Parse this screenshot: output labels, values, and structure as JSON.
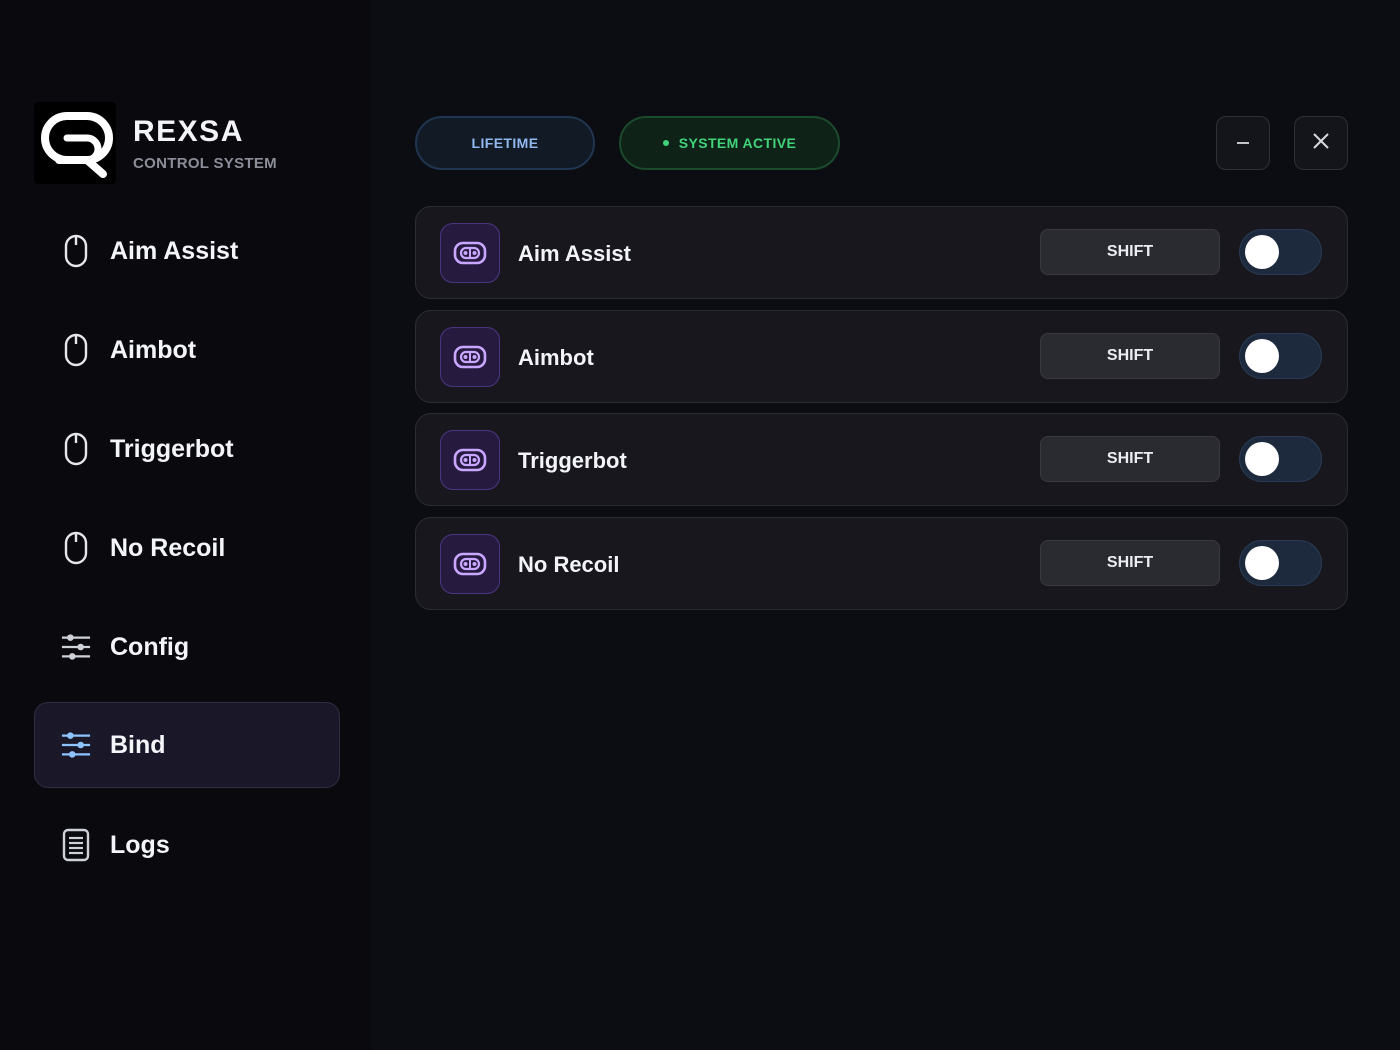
{
  "brand": {
    "title": "REXSA",
    "subtitle": "CONTROL SYSTEM",
    "logo_icon": "rexsa-logo-icon"
  },
  "sidebar": {
    "items": [
      {
        "label": "Aim Assist",
        "icon": "mouse-icon",
        "active": false
      },
      {
        "label": "Aimbot",
        "icon": "mouse-icon",
        "active": false
      },
      {
        "label": "Triggerbot",
        "icon": "mouse-icon",
        "active": false
      },
      {
        "label": "No Recoil",
        "icon": "mouse-icon",
        "active": false
      },
      {
        "label": "Config",
        "icon": "sliders-icon",
        "active": false
      },
      {
        "label": "Bind",
        "icon": "sliders-icon",
        "active": true
      },
      {
        "label": "Logs",
        "icon": "document-icon",
        "active": false
      }
    ]
  },
  "header": {
    "license_label": "LIFETIME",
    "status_label": "SYSTEM ACTIVE",
    "minimize_icon": "minimize-icon",
    "close_icon": "close-icon"
  },
  "features": [
    {
      "label": "Aim Assist",
      "bind": "SHIFT",
      "enabled": false,
      "icon": "gamepad-icon"
    },
    {
      "label": "Aimbot",
      "bind": "SHIFT",
      "enabled": false,
      "icon": "gamepad-icon"
    },
    {
      "label": "Triggerbot",
      "bind": "SHIFT",
      "enabled": false,
      "icon": "gamepad-icon"
    },
    {
      "label": "No Recoil",
      "bind": "SHIFT",
      "enabled": false,
      "icon": "gamepad-icon"
    }
  ],
  "colors": {
    "background": "#0c0d12",
    "sidebar": "#0a0a0e",
    "accent_purple": "#b68cff",
    "status_green": "#41d27a",
    "license_blue": "#8fb8ee"
  }
}
